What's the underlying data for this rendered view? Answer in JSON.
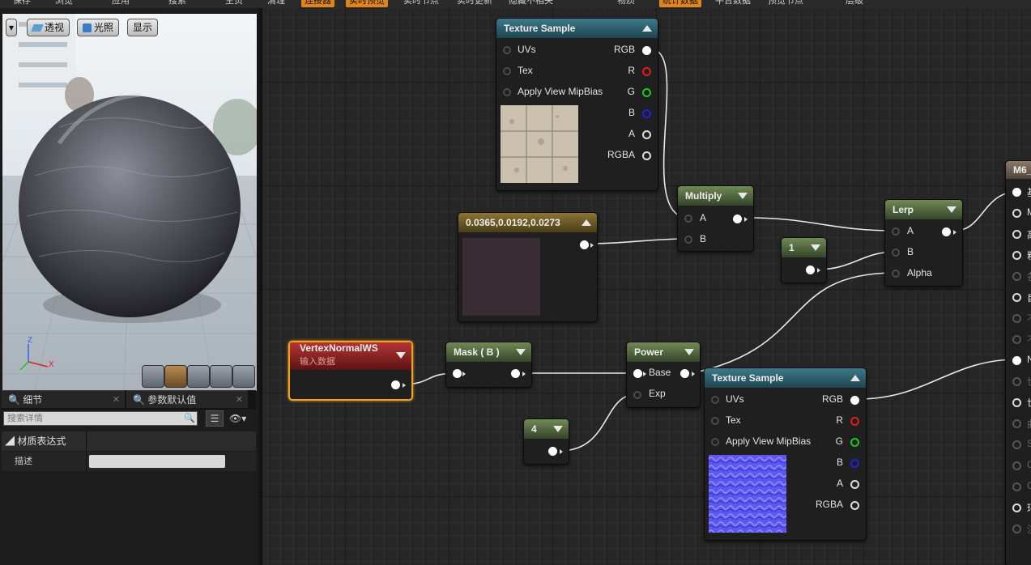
{
  "toolbar": {
    "items": [
      {
        "label": "保存",
        "hl": false
      },
      {
        "label": "浏览",
        "hl": false
      },
      {
        "label": "应用",
        "hl": false
      },
      {
        "label": "搜索",
        "hl": false
      },
      {
        "label": "主页",
        "hl": false
      },
      {
        "label": "清理",
        "hl": false
      },
      {
        "label": "连接器",
        "hl": true
      },
      {
        "label": "实时预览",
        "hl": true
      },
      {
        "label": "实时节点",
        "hl": false
      },
      {
        "label": "实时更新",
        "hl": false
      },
      {
        "label": "隐藏不相关",
        "hl": false
      },
      {
        "label": "物质",
        "hl": false
      },
      {
        "label": "统计数据",
        "hl": true
      },
      {
        "label": "平台数据",
        "hl": false
      },
      {
        "label": "预览节点",
        "hl": false
      },
      {
        "label": "层级",
        "hl": false
      }
    ]
  },
  "viewport": {
    "menu_arrow": "▾",
    "perspective_label": "透视",
    "lighting_label": "光照",
    "show_label": "显示",
    "axis": {
      "z": "Z",
      "x": "X"
    }
  },
  "details_panel": {
    "tab_details": "细节",
    "tab_params": "参数默认值",
    "search_placeholder": "搜索详情",
    "section_title": "材质表达式",
    "row_label": "描述",
    "row_value": ""
  },
  "nodes": {
    "tex1": {
      "title": "Texture Sample",
      "inputs": [
        "UVs",
        "Tex",
        "Apply View MipBias"
      ],
      "outputs": [
        "RGB",
        "R",
        "G",
        "B",
        "A",
        "RGBA"
      ]
    },
    "const3": {
      "title": "0.0365,0.0192,0.0273",
      "swatch_color": "#3a2c34"
    },
    "multiply": {
      "title": "Multiply",
      "inputs": [
        "A",
        "B"
      ]
    },
    "one": {
      "title": "1"
    },
    "lerp": {
      "title": "Lerp",
      "inputs": [
        "A",
        "B",
        "Alpha"
      ]
    },
    "vertex": {
      "title": "VertexNormalWS",
      "subtitle": "输入数据"
    },
    "mask": {
      "title": "Mask ( B )"
    },
    "power": {
      "title": "Power",
      "inputs": [
        "Base",
        "Exp"
      ]
    },
    "four": {
      "title": "4"
    },
    "tex2": {
      "title": "Texture Sample",
      "inputs": [
        "UVs",
        "Tex",
        "Apply View MipBias"
      ],
      "outputs": [
        "RGB",
        "R",
        "G",
        "B",
        "A",
        "RGBA"
      ]
    },
    "material": {
      "title": "M6_",
      "pins": [
        "基",
        "M",
        "高",
        "粗",
        "各",
        "自",
        "不",
        "不",
        "N",
        "世",
        "世",
        "曲",
        "S",
        "C",
        "C",
        "环",
        "注"
      ]
    }
  },
  "colors": {
    "accent_orange": "#e0851a",
    "pin_r": "#e01c1c",
    "pin_g": "#1ec81e",
    "pin_b": "#2020e0"
  }
}
